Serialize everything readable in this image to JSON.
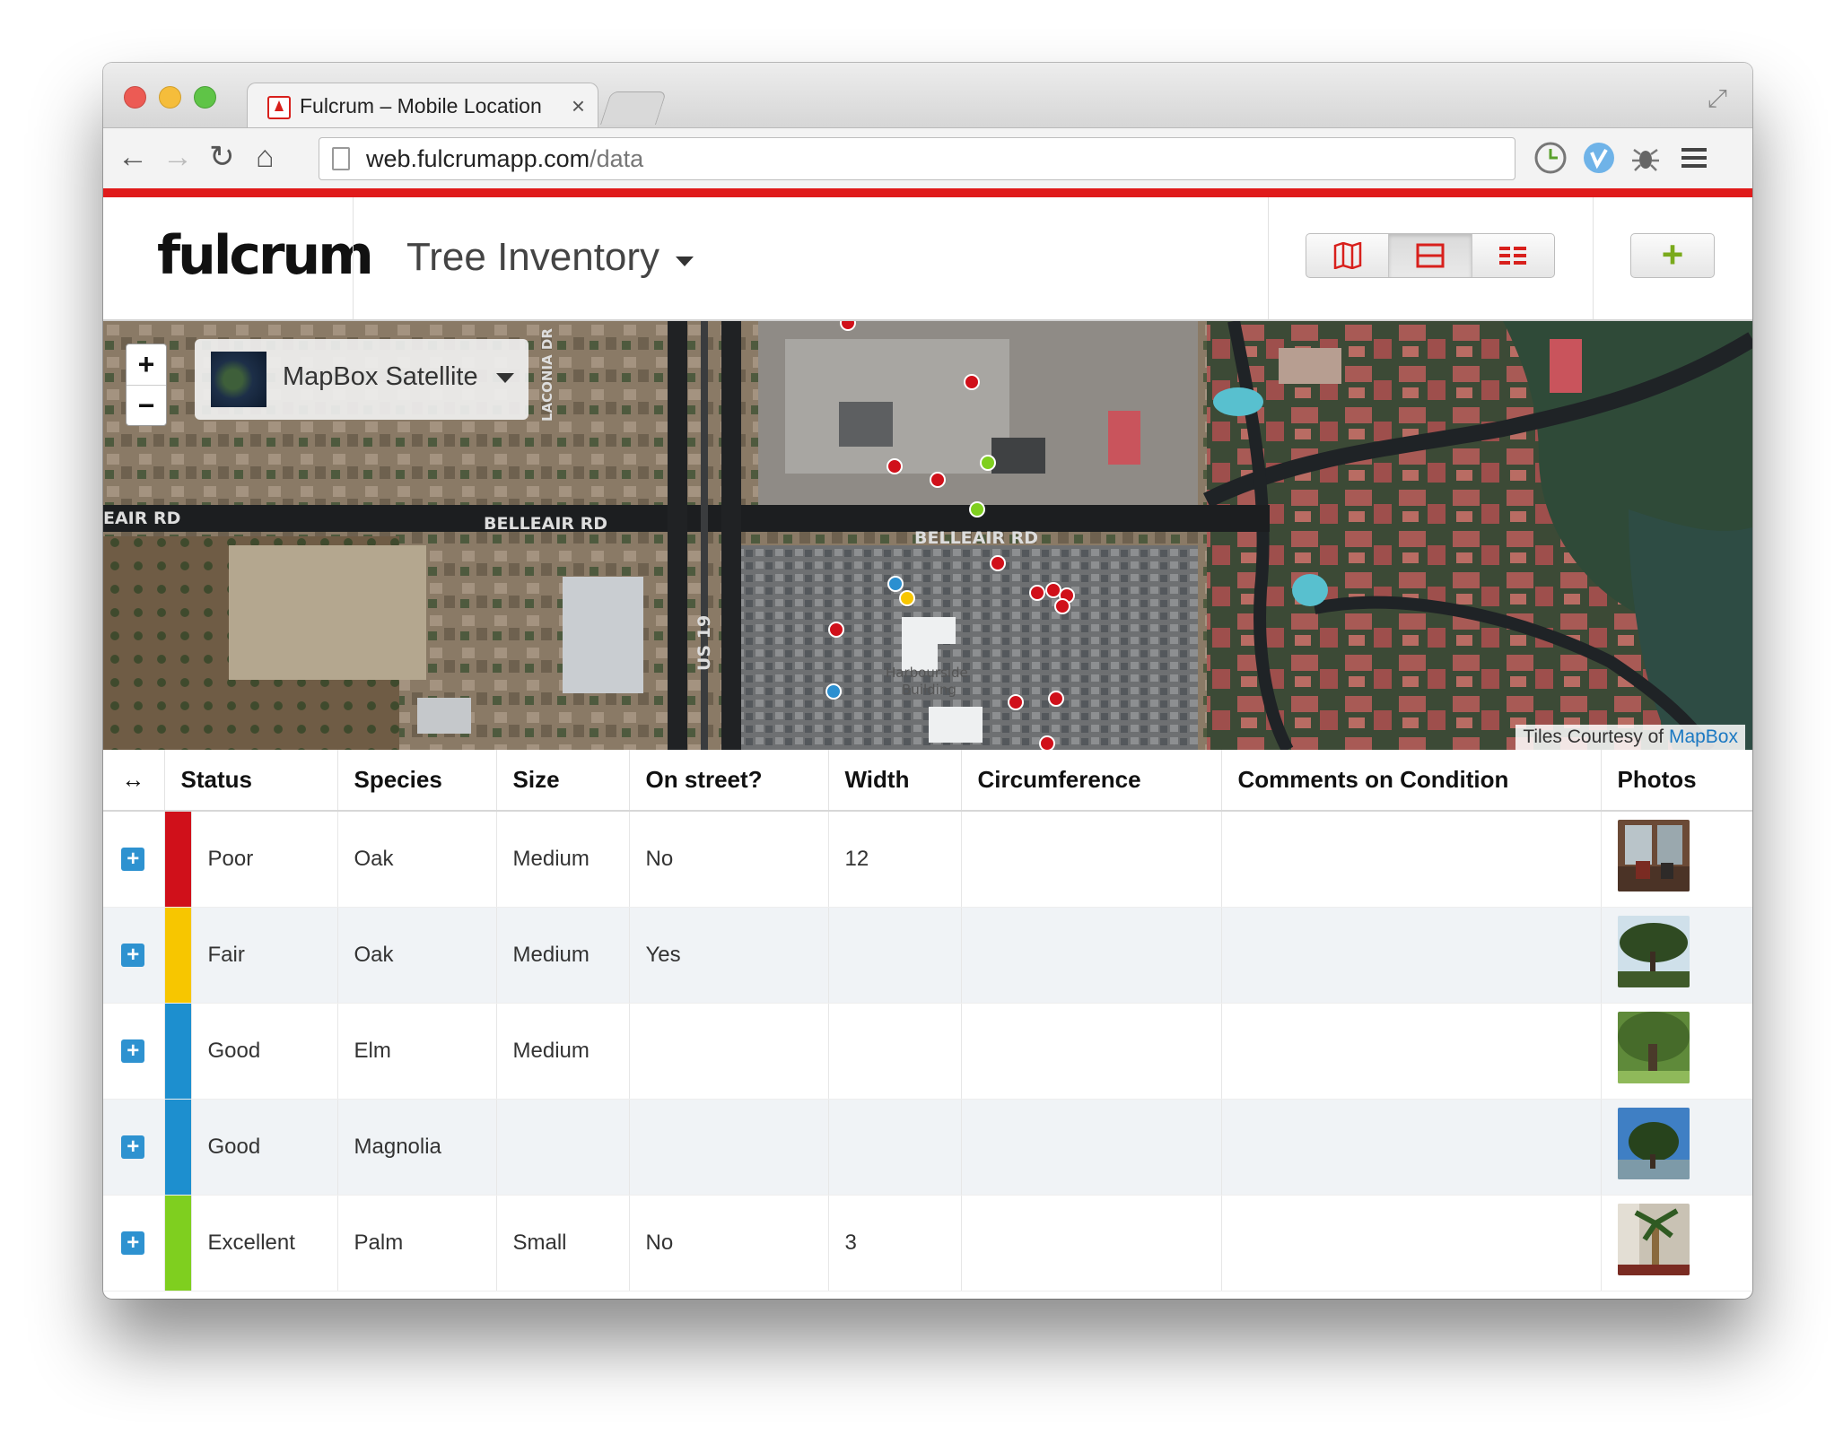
{
  "browser": {
    "tab_title": "Fulcrum – Mobile Location",
    "tab_close": "×",
    "url_host": "web.fulcrumapp.com",
    "url_path": "/data"
  },
  "app": {
    "logo": "fulcrum",
    "project_name": "Tree Inventory",
    "accent_color": "#e01b1b",
    "add_button": "+"
  },
  "map": {
    "zoom_in": "+",
    "zoom_out": "−",
    "layer_name": "MapBox Satellite",
    "attribution_prefix": "Tiles Courtesy of",
    "attribution_link": "MapBox",
    "road_labels": [
      "EAIR RD",
      "BELLEAIR RD",
      "BELLEAIR RD",
      "US 19",
      "LACONIA DR",
      "Harbourside Building"
    ],
    "marker_colors": {
      "poor": "#d0101a",
      "fair": "#f7c600",
      "good": "#2b8fd0",
      "excellent": "#7fcf1f"
    }
  },
  "table": {
    "expand_header": "↔",
    "columns": [
      "Status",
      "Species",
      "Size",
      "On street?",
      "Width",
      "Circumference",
      "Comments on Condition",
      "Photos"
    ],
    "rows": [
      {
        "status": "Poor",
        "status_color": "#d0101a",
        "species": "Oak",
        "size": "Medium",
        "on_street": "No",
        "width": "12",
        "circumference": "",
        "comments": "",
        "photo": "interior-photo"
      },
      {
        "status": "Fair",
        "status_color": "#f7c600",
        "species": "Oak",
        "size": "Medium",
        "on_street": "Yes",
        "width": "",
        "circumference": "",
        "comments": "",
        "photo": "oak-tree-photo"
      },
      {
        "status": "Good",
        "status_color": "#1d8fcf",
        "species": "Elm",
        "size": "Medium",
        "on_street": "",
        "width": "",
        "circumference": "",
        "comments": "",
        "photo": "elm-tree-photo"
      },
      {
        "status": "Good",
        "status_color": "#1d8fcf",
        "species": "Magnolia",
        "size": "",
        "on_street": "",
        "width": "",
        "circumference": "",
        "comments": "",
        "photo": "magnolia-tree-photo"
      },
      {
        "status": "Excellent",
        "status_color": "#7fcf1f",
        "species": "Palm",
        "size": "Small",
        "on_street": "No",
        "width": "3",
        "circumference": "",
        "comments": "",
        "photo": "palm-tree-photo"
      }
    ]
  }
}
